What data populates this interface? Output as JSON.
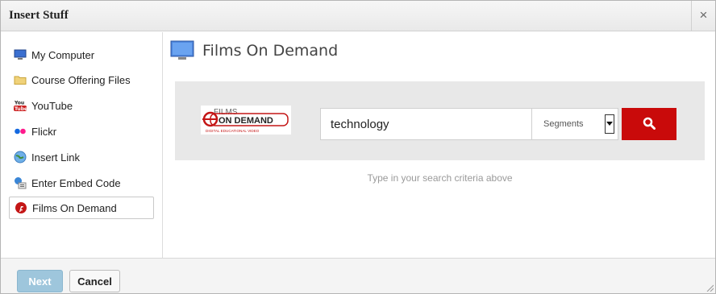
{
  "dialog": {
    "title": "Insert Stuff",
    "close_glyph": "×"
  },
  "sidebar": {
    "items": [
      {
        "label": "My Computer",
        "icon": "monitor-icon"
      },
      {
        "label": "Course Offering Files",
        "icon": "folder-icon"
      },
      {
        "label": "YouTube",
        "icon": "youtube-icon"
      },
      {
        "label": "Flickr",
        "icon": "flickr-icon"
      },
      {
        "label": "Insert Link",
        "icon": "globe-link-icon"
      },
      {
        "label": "Enter Embed Code",
        "icon": "embed-code-icon"
      },
      {
        "label": "Films On Demand",
        "icon": "films-on-demand-icon",
        "selected": true
      }
    ]
  },
  "main": {
    "heading": "Films On Demand",
    "logo": {
      "line1": "FILMS",
      "line2": "ON DEMAND",
      "tagline": "DIGITAL EDUCATIONAL VIDEO"
    },
    "search": {
      "value": "technology",
      "select_value": "Segments"
    },
    "hint": "Type in your search criteria above"
  },
  "footer": {
    "next_label": "Next",
    "cancel_label": "Cancel"
  },
  "colors": {
    "accent_red": "#c90a0a",
    "next_disabled": "#9ec6dc"
  }
}
